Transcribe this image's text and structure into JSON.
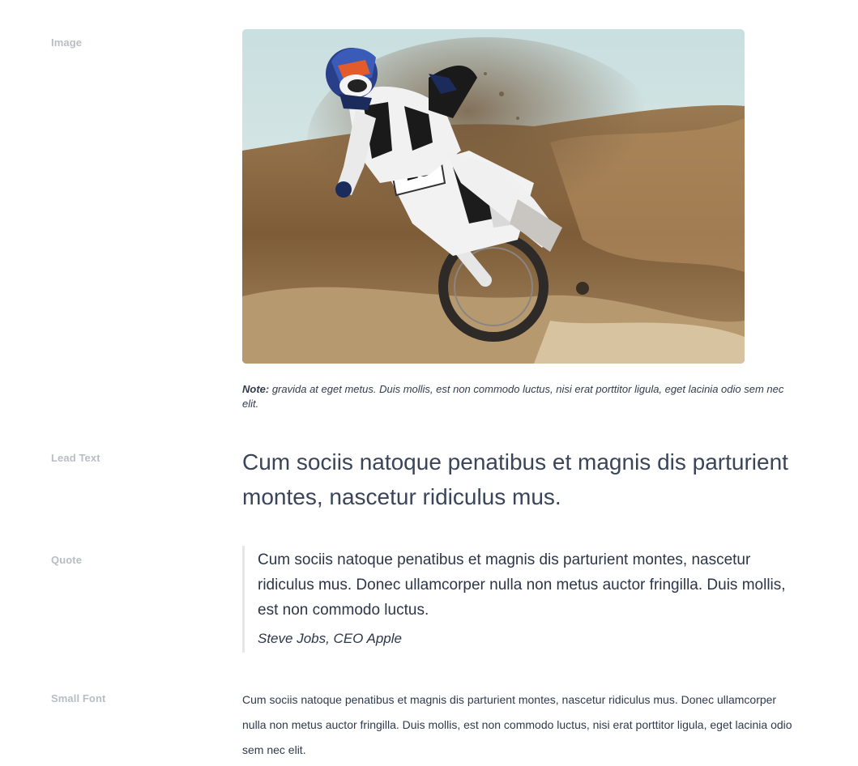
{
  "rows": {
    "image": {
      "label": "Image",
      "photo_alt": "Motocross rider on a dirt bike kicking up sand",
      "note_label": "Note:",
      "note_text": " gravida at eget metus. Duis mollis, est non commodo luctus, nisi erat porttitor ligula, eget lacinia odio sem nec elit."
    },
    "lead": {
      "label": "Lead Text",
      "text": "Cum sociis natoque penatibus et magnis dis parturient montes, nascetur ridiculus mus."
    },
    "quote": {
      "label": "Quote",
      "text": "Cum sociis natoque penatibus et magnis dis parturient montes, nascetur ridiculus mus. Donec ullamcorper nulla non metus auctor fringilla. Duis mollis, est non commodo luctus.",
      "cite": "Steve Jobs, CEO Apple"
    },
    "small": {
      "label": "Small Font",
      "text": "Cum sociis natoque penatibus et magnis dis parturient montes, nascetur ridiculus mus. Donec ullamcorper nulla non metus auctor fringilla. Duis mollis, est non commodo luctus, nisi erat porttitor ligula, eget lacinia odio sem nec elit."
    }
  }
}
